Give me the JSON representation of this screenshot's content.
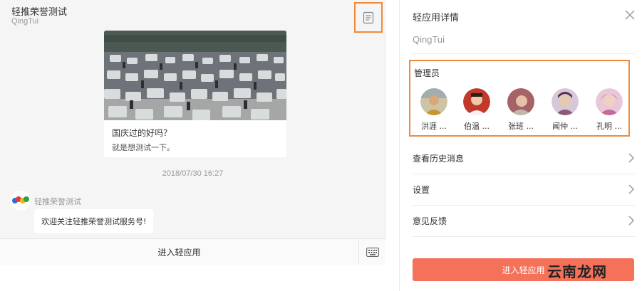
{
  "chat": {
    "title": "轻推荣誉测试",
    "subtitle": "QingTui",
    "article": {
      "title": "国庆过的好吗？",
      "desc": "就是想测试一下。"
    },
    "timestamp": "2018/07/30 16:27",
    "bot_name": "轻推荣誉测试",
    "bot_message": "欢迎关注轻推荣誉测试服务号!",
    "enter_app_label": "进入轻应用"
  },
  "detail": {
    "title": "轻应用详情",
    "subtitle": "QingTui",
    "admin_label": "管理员",
    "admins": [
      {
        "name": "洪涯 ...",
        "color": "#b88a5a"
      },
      {
        "name": "伯温 ...",
        "color": "#c0392b"
      },
      {
        "name": "张班 ...",
        "color": "#a0525a"
      },
      {
        "name": "闻仲 ...",
        "color": "#8a5a7a"
      },
      {
        "name": "孔明 ...",
        "color": "#b85a8a"
      }
    ],
    "menu": [
      {
        "label": "查看历史消息"
      },
      {
        "label": "设置"
      },
      {
        "label": "意见反馈"
      }
    ],
    "enter_button": "进入轻应用",
    "watermark": "云南龙网"
  },
  "colors": {
    "accent_orange": "#ef8a3a",
    "enter_button": "#f5715a"
  }
}
